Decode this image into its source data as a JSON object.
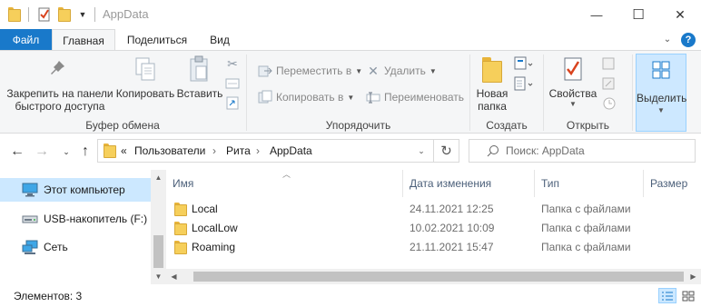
{
  "window": {
    "title": "AppData",
    "controls": {
      "minimize": "—",
      "maximize": "☐",
      "close": "✕"
    }
  },
  "tabs": [
    {
      "label": "Файл",
      "state": "file"
    },
    {
      "label": "Главная",
      "state": "active"
    },
    {
      "label": "Поделиться",
      "state": "normal"
    },
    {
      "label": "Вид",
      "state": "normal"
    }
  ],
  "help_label": "?",
  "ribbon": {
    "clipboard": {
      "pin_label_1": "Закрепить на панели",
      "pin_label_2": "быстрого доступа",
      "copy_label": "Копировать",
      "paste_label": "Вставить",
      "group_label": "Буфер обмена"
    },
    "organize": {
      "move_to": "Переместить в",
      "copy_to": "Копировать в",
      "delete": "Удалить",
      "rename": "Переименовать",
      "group_label": "Упорядочить"
    },
    "new": {
      "new_folder_1": "Новая",
      "new_folder_2": "папка",
      "group_label": "Создать"
    },
    "open": {
      "properties": "Свойства",
      "group_label": "Открыть"
    },
    "select": {
      "label": "Выделить"
    }
  },
  "address": {
    "overflow": "«",
    "crumbs": [
      "Пользователи",
      "Рита",
      "AppData"
    ],
    "separator": "›"
  },
  "search": {
    "placeholder": "Поиск: AppData"
  },
  "nav_pane": {
    "items": [
      {
        "label": "Этот компьютер",
        "icon": "computer-icon",
        "selected": true
      },
      {
        "label": "USB-накопитель (F:)",
        "icon": "usb-drive-icon",
        "selected": false
      },
      {
        "label": "Сеть",
        "icon": "network-icon",
        "selected": false
      }
    ]
  },
  "file_list": {
    "columns": [
      "Имя",
      "Дата изменения",
      "Тип",
      "Размер"
    ],
    "rows": [
      {
        "name": "Local",
        "date": "24.11.2021 12:25",
        "type": "Папка с файлами"
      },
      {
        "name": "LocalLow",
        "date": "10.02.2021 10:09",
        "type": "Папка с файлами"
      },
      {
        "name": "Roaming",
        "date": "21.11.2021 15:47",
        "type": "Папка с файлами"
      }
    ]
  },
  "status": {
    "item_count": "Элементов: 3"
  },
  "colors": {
    "accent": "#1979ca",
    "selection": "#cce8ff",
    "folder": "#f6cf5b"
  }
}
